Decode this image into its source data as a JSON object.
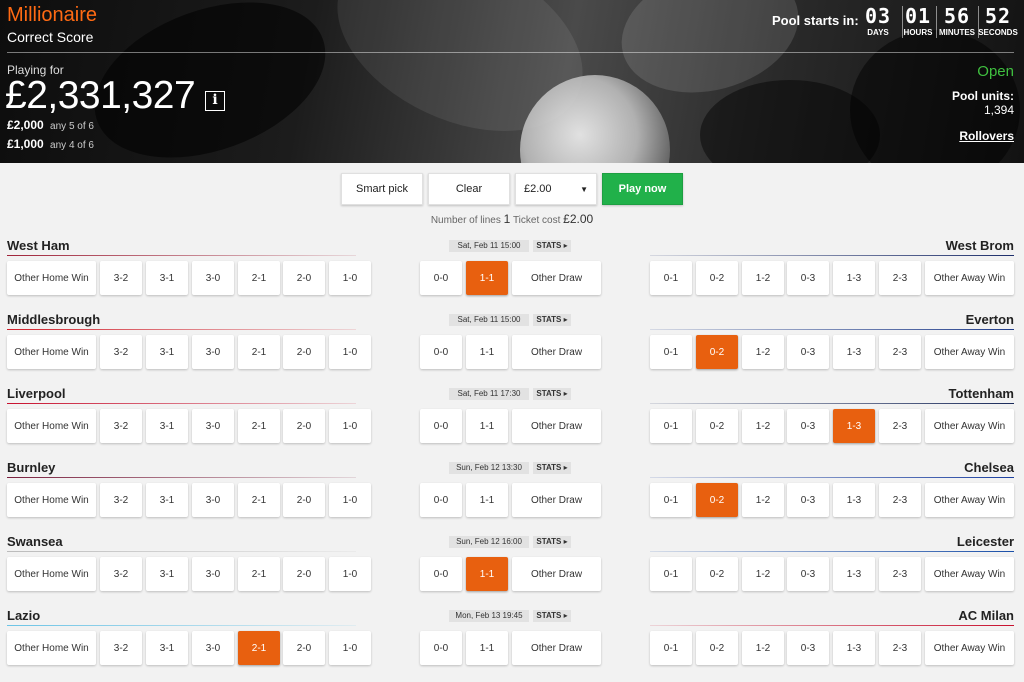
{
  "header": {
    "game_name": "Millionaire",
    "game_subtitle": "Correct Score",
    "pool_starts_label": "Pool starts in:",
    "countdown": [
      {
        "value": "03",
        "label": "DAYS"
      },
      {
        "value": "01",
        "label": "HOURS"
      },
      {
        "value": "56",
        "label": "MINUTES"
      },
      {
        "value": "52",
        "label": "SECONDS"
      }
    ],
    "playing_for_label": "Playing for",
    "jackpot": "£2,331,327",
    "info_icon": "i",
    "prizes": [
      {
        "amount": "£2,000",
        "desc": "any 5 of 6"
      },
      {
        "amount": "£1,000",
        "desc": "any 4 of 6"
      }
    ],
    "status": "Open",
    "pool_units_label": "Pool units:",
    "pool_units_value": "1,394",
    "rollovers_link": "Rollovers"
  },
  "controls": {
    "smart_pick": "Smart pick",
    "clear": "Clear",
    "stake_value": "£2.00",
    "play_now": "Play now",
    "lines_label": "Number of lines",
    "lines_value": "1",
    "ticket_cost_label": "Ticket cost",
    "ticket_cost_value": "£2.00"
  },
  "outcome_labels": {
    "home": [
      "Other Home Win",
      "3-2",
      "3-1",
      "3-0",
      "2-1",
      "2-0",
      "1-0"
    ],
    "draw": [
      "0-0",
      "1-1",
      "Other Draw"
    ],
    "away": [
      "0-1",
      "0-2",
      "1-2",
      "0-3",
      "1-3",
      "2-3",
      "Other Away Win"
    ]
  },
  "stats_label": "STATS ▸",
  "matches": [
    {
      "home": "West Ham",
      "away": "West Brom",
      "kickoff": "Sat, Feb 11 15:00",
      "selected": "1-1",
      "home_color": "#a0243a",
      "away_color": "#1d2e6b"
    },
    {
      "home": "Middlesbrough",
      "away": "Everton",
      "kickoff": "Sat, Feb 11 15:00",
      "selected": "0-2",
      "home_color": "#d11f2a",
      "away_color": "#1e3b8a"
    },
    {
      "home": "Liverpool",
      "away": "Tottenham",
      "kickoff": "Sat, Feb 11 17:30",
      "selected": "1-3",
      "home_color": "#c8102e",
      "away_color": "#1a2a5a"
    },
    {
      "home": "Burnley",
      "away": "Chelsea",
      "kickoff": "Sun, Feb 12 13:30",
      "selected": "0-2",
      "home_color": "#7a1f3d",
      "away_color": "#1b3fa0"
    },
    {
      "home": "Swansea",
      "away": "Leicester",
      "kickoff": "Sun, Feb 12 16:00",
      "selected": "1-1",
      "home_color": "#bbbbbb",
      "away_color": "#1a4fa8"
    },
    {
      "home": "Lazio",
      "away": "AC Milan",
      "kickoff": "Mon, Feb 13 19:45",
      "selected": "2-1",
      "home_color": "#6cc4e6",
      "away_color": "#c8102e"
    }
  ]
}
